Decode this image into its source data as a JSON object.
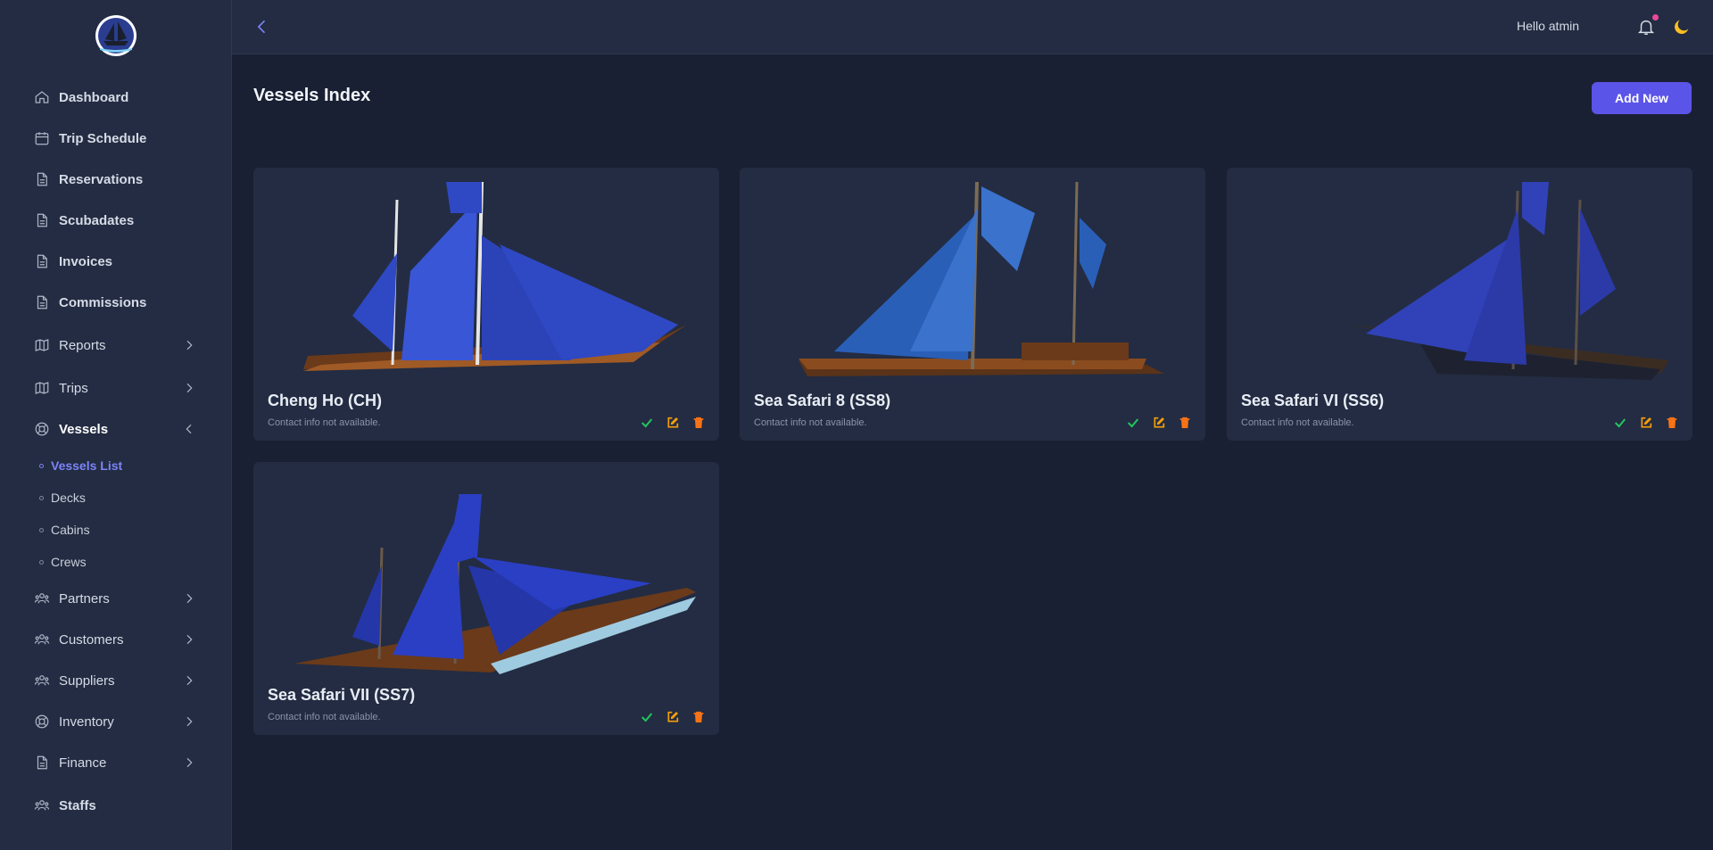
{
  "header": {
    "greeting": "Hello atmin"
  },
  "sidebar": {
    "items": [
      {
        "label": "Dashboard",
        "icon": "home-icon"
      },
      {
        "label": "Trip Schedule",
        "icon": "calendar-icon"
      },
      {
        "label": "Reservations",
        "icon": "document-icon"
      },
      {
        "label": "Scubadates",
        "icon": "document-icon"
      },
      {
        "label": "Invoices",
        "icon": "document-icon"
      },
      {
        "label": "Commissions",
        "icon": "document-icon"
      },
      {
        "label": "Reports",
        "icon": "map-icon"
      },
      {
        "label": "Trips",
        "icon": "map-icon"
      },
      {
        "label": "Vessels",
        "icon": "lifebuoy-icon"
      },
      {
        "label": "Partners",
        "icon": "users-icon"
      },
      {
        "label": "Customers",
        "icon": "users-icon"
      },
      {
        "label": "Suppliers",
        "icon": "users-icon"
      },
      {
        "label": "Inventory",
        "icon": "lifebuoy-icon"
      },
      {
        "label": "Finance",
        "icon": "document-icon"
      },
      {
        "label": "Staffs",
        "icon": "users-icon"
      }
    ],
    "vessels_sub": [
      {
        "label": "Vessels List"
      },
      {
        "label": "Decks"
      },
      {
        "label": "Cabins"
      },
      {
        "label": "Crews"
      }
    ]
  },
  "main": {
    "title": "Vessels Index",
    "add_label": "Add New",
    "vessels": [
      {
        "name": "Cheng Ho (CH)",
        "contact": "Contact info not available."
      },
      {
        "name": "Sea Safari 8 (SS8)",
        "contact": "Contact info not available."
      },
      {
        "name": "Sea Safari VI (SS6)",
        "contact": "Contact info not available."
      },
      {
        "name": "Sea Safari VII (SS7)",
        "contact": "Contact info not available."
      }
    ]
  },
  "colors": {
    "accent": "#5b54e8",
    "check": "#22c55e",
    "edit": "#f59e0b",
    "delete": "#f97316",
    "sail": "#2f48c4"
  }
}
